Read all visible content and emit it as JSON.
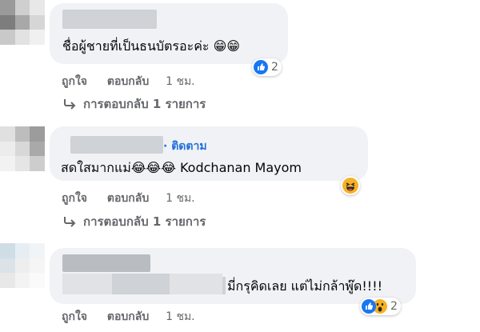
{
  "comments": [
    {
      "text": "ชื่อผู้ชายที่เป็นธนบัตรอะค่ะ 😁😁",
      "actions": {
        "like": "ถูกใจ",
        "reply": "ตอบกลับ",
        "time": "1 ชม."
      },
      "reaction_count": "2",
      "replies_label": "การตอบกลับ 1 รายการ"
    },
    {
      "follow_label": "· ติดตาม",
      "text": "สดใสมากแม่😂😂😂 Kodchanan Mayom",
      "actions": {
        "like": "ถูกใจ",
        "reply": "ตอบกลับ",
        "time": "1 ชม."
      },
      "replies_label": "การตอบกลับ 1 รายการ"
    },
    {
      "text": "มี่กรุคิดเลย แต่ไม่กล้าพู๊ด!!!!",
      "actions": {
        "like": "ถูกใจ",
        "reply": "ตอบกลับ",
        "time": "1 ชม."
      },
      "reaction_count": "2"
    }
  ],
  "icons": {
    "like": "like-reaction-icon",
    "haha": "haha-reaction-icon",
    "wow": "wow-reaction-icon",
    "reply_arrow": "reply-arrow-icon"
  },
  "colors": {
    "bubble": "#f0f2f5",
    "meta_text": "#65676b",
    "link_blue": "#216fdb",
    "like_blue": "#1877f2",
    "emoji_yellow": "#f7b125"
  }
}
